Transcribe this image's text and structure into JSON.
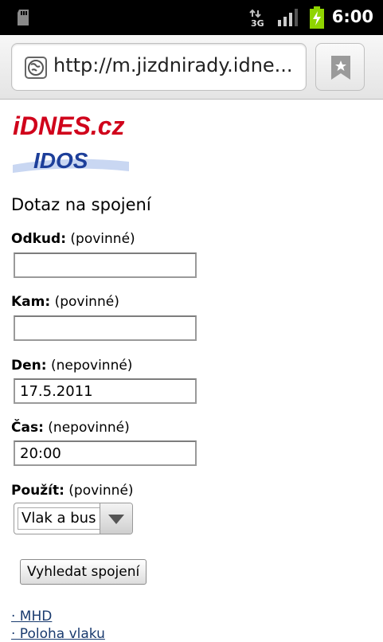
{
  "status_bar": {
    "time": "6:00",
    "network_type": "3G",
    "icons": [
      "sd-card-icon",
      "network-3g-icon",
      "signal-icon",
      "battery-charging-icon"
    ]
  },
  "browser": {
    "url": "http://m.jizdnirady.idne...",
    "icons": [
      "globe-icon",
      "bookmark-icon"
    ]
  },
  "logos": {
    "idnes": "iDNES.cz",
    "idos": "IDOS"
  },
  "form": {
    "heading": "Dotaz na spojení",
    "from": {
      "label": "Odkud:",
      "hint": "(povinné)",
      "value": ""
    },
    "to": {
      "label": "Kam:",
      "hint": "(povinné)",
      "value": ""
    },
    "date": {
      "label": "Den:",
      "hint": "(nepovinné)",
      "value": "17.5.2011"
    },
    "time": {
      "label": "Čas:",
      "hint": "(nepovinné)",
      "value": "20:00"
    },
    "use": {
      "label": "Použít:",
      "hint": "(povinné)",
      "selected": "Vlak a bus"
    },
    "submit_label": "Vyhledat spojení"
  },
  "links": [
    {
      "label": "· MHD"
    },
    {
      "label": "· Poloha vlaku"
    }
  ],
  "colors": {
    "status_bar_bg": "#000000",
    "link": "#1a3b6f",
    "idnes_red": "#d0021b",
    "idos_blue": "#1d3f9a"
  }
}
